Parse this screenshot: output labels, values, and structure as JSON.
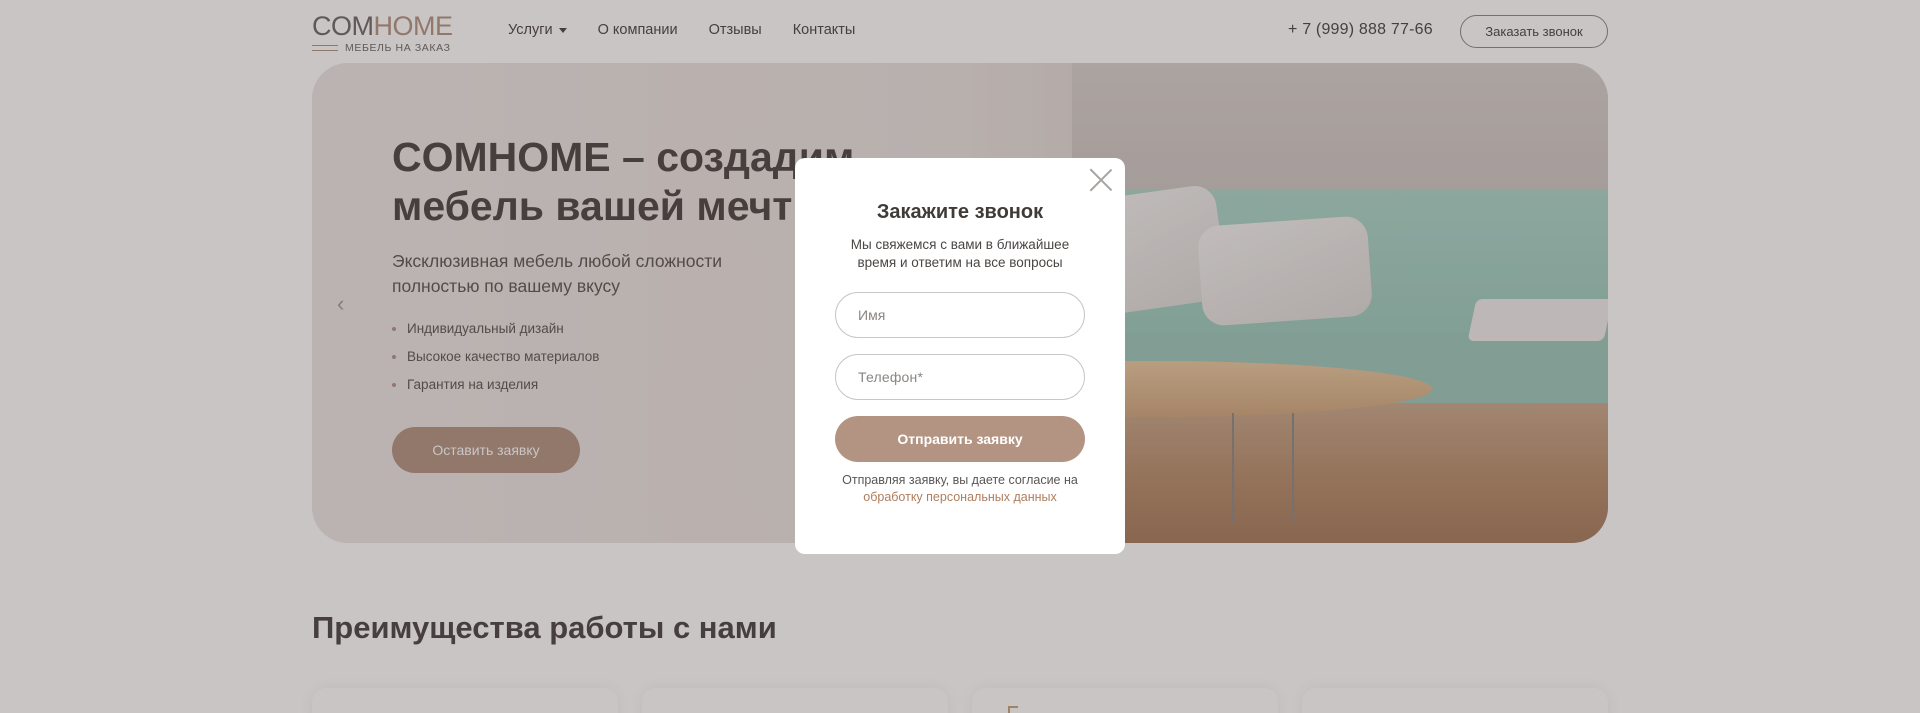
{
  "header": {
    "logo": {
      "part_a": "COM",
      "part_b": "HOME",
      "subtitle": "МЕБЕЛЬ НА ЗАКАЗ"
    },
    "nav": [
      {
        "label": "Услуги",
        "has_dropdown": true
      },
      {
        "label": "О компании"
      },
      {
        "label": "Отзывы"
      },
      {
        "label": "Контакты"
      }
    ],
    "phone": "+ 7 (999) 888 77-66",
    "callback_button": "Заказать звонок"
  },
  "hero": {
    "title": "COMHOME – создадим мебель вашей мечты",
    "subtitle": "Эксклюзивная мебель любой сложности полностью по вашему вкусу",
    "features": [
      "Индивидуальный дизайн",
      "Высокое качество материалов",
      "Гарантия на изделия"
    ],
    "cta": "Оставить заявку",
    "prev_arrow": "‹"
  },
  "advantages": {
    "title": "Преимущества работы с нами"
  },
  "modal": {
    "title": "Закажите звонок",
    "description": "Мы свяжемся с вами в ближайшее время и ответим на все вопросы",
    "name_placeholder": "Имя",
    "phone_placeholder": "Телефон*",
    "submit": "Отправить заявку",
    "consent_prefix": "Отправляя заявку, вы даете согласие на ",
    "consent_link": "обработку персональных данных"
  },
  "colors": {
    "accent": "#b39483",
    "text": "#4a4643",
    "overlay": "rgba(60,48,48,0.28)",
    "link": "#b07d5d"
  }
}
